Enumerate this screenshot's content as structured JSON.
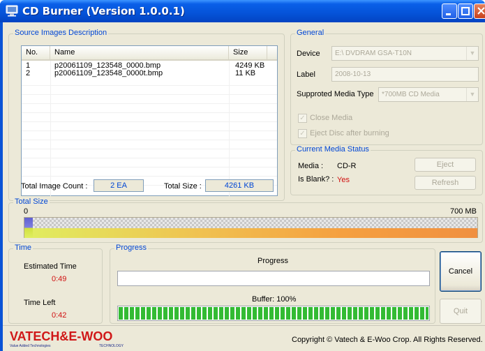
{
  "window": {
    "title": "CD Burner (Version 1.0.0.1)"
  },
  "source": {
    "group_label": "Source Images Description",
    "columns": [
      "No.",
      "Name",
      "Size"
    ],
    "rows": [
      {
        "no": "1",
        "name": "p20061109_123548_0000.bmp",
        "size": "4249 KB"
      },
      {
        "no": "2",
        "name": "p20061109_123548_0000t.bmp",
        "size": "11 KB"
      }
    ],
    "total_count_label": "Total Image Count :",
    "total_count_value": "2 EA",
    "total_size_label": "Total Size :",
    "total_size_value": "4261 KB"
  },
  "general": {
    "group_label": "General",
    "device_label": "Device",
    "device_value": "E:\\ DVDRAM GSA-T10N",
    "label_label": "Label",
    "label_value": "2008-10-13",
    "media_type_label": "Supproted Media Type",
    "media_type_value": "*700MB CD Media",
    "close_media_label": "Close Media",
    "eject_label": "Eject Disc after burning"
  },
  "media_status": {
    "group_label": "Current Media Status",
    "media_label": "Media :",
    "media_value": "CD-R",
    "blank_label": "Is Blank? :",
    "blank_value": "Yes",
    "eject_button": "Eject",
    "refresh_button": "Refresh"
  },
  "total_size": {
    "group_label": "Total Size",
    "min_label": "0",
    "max_label": "700 MB"
  },
  "time": {
    "group_label": "Time",
    "estimated_label": "Estimated Time",
    "estimated_value": "0:49",
    "left_label": "Time Left",
    "left_value": "0:42"
  },
  "progress": {
    "group_label": "Progress",
    "progress_label": "Progress",
    "progress_value": 0,
    "buffer_label": "Buffer: 100%",
    "buffer_value": 1.0
  },
  "buttons": {
    "cancel": "Cancel",
    "quit": "Quit"
  },
  "footer": {
    "logo_text": "VATECH&E-WOO",
    "logo_tagline": "Value Added Technologies",
    "logo_sub": "TECHNOLOGY",
    "copyright": "Copyright © Vatech & E-Woo Crop. All Rights Reserved."
  },
  "colors": {
    "accent_blue": "#0046d5",
    "time_red": "#d01010",
    "buffer_green": "#33bb33"
  }
}
